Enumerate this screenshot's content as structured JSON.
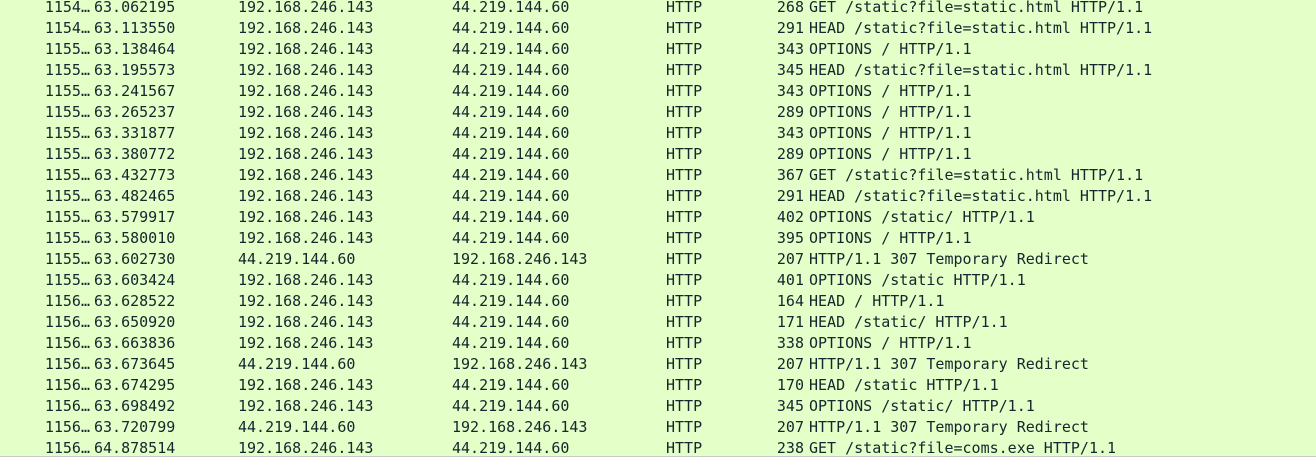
{
  "colors": {
    "row_background": "#e4ffc7",
    "text": "#12272e"
  },
  "packets": [
    {
      "no": "1154…",
      "time": "63.062195",
      "source": "192.168.246.143",
      "destination": "44.219.144.60",
      "protocol": "HTTP",
      "length": "268",
      "info": "GET /static?file=static.html HTTP/1.1"
    },
    {
      "no": "1154…",
      "time": "63.113550",
      "source": "192.168.246.143",
      "destination": "44.219.144.60",
      "protocol": "HTTP",
      "length": "291",
      "info": "HEAD /static?file=static.html HTTP/1.1"
    },
    {
      "no": "1155…",
      "time": "63.138464",
      "source": "192.168.246.143",
      "destination": "44.219.144.60",
      "protocol": "HTTP",
      "length": "343",
      "info": "OPTIONS / HTTP/1.1"
    },
    {
      "no": "1155…",
      "time": "63.195573",
      "source": "192.168.246.143",
      "destination": "44.219.144.60",
      "protocol": "HTTP",
      "length": "345",
      "info": "HEAD /static?file=static.html HTTP/1.1"
    },
    {
      "no": "1155…",
      "time": "63.241567",
      "source": "192.168.246.143",
      "destination": "44.219.144.60",
      "protocol": "HTTP",
      "length": "343",
      "info": "OPTIONS / HTTP/1.1"
    },
    {
      "no": "1155…",
      "time": "63.265237",
      "source": "192.168.246.143",
      "destination": "44.219.144.60",
      "protocol": "HTTP",
      "length": "289",
      "info": "OPTIONS / HTTP/1.1"
    },
    {
      "no": "1155…",
      "time": "63.331877",
      "source": "192.168.246.143",
      "destination": "44.219.144.60",
      "protocol": "HTTP",
      "length": "343",
      "info": "OPTIONS / HTTP/1.1"
    },
    {
      "no": "1155…",
      "time": "63.380772",
      "source": "192.168.246.143",
      "destination": "44.219.144.60",
      "protocol": "HTTP",
      "length": "289",
      "info": "OPTIONS / HTTP/1.1"
    },
    {
      "no": "1155…",
      "time": "63.432773",
      "source": "192.168.246.143",
      "destination": "44.219.144.60",
      "protocol": "HTTP",
      "length": "367",
      "info": "GET /static?file=static.html HTTP/1.1"
    },
    {
      "no": "1155…",
      "time": "63.482465",
      "source": "192.168.246.143",
      "destination": "44.219.144.60",
      "protocol": "HTTP",
      "length": "291",
      "info": "HEAD /static?file=static.html HTTP/1.1"
    },
    {
      "no": "1155…",
      "time": "63.579917",
      "source": "192.168.246.143",
      "destination": "44.219.144.60",
      "protocol": "HTTP",
      "length": "402",
      "info": "OPTIONS /static/ HTTP/1.1"
    },
    {
      "no": "1155…",
      "time": "63.580010",
      "source": "192.168.246.143",
      "destination": "44.219.144.60",
      "protocol": "HTTP",
      "length": "395",
      "info": "OPTIONS / HTTP/1.1"
    },
    {
      "no": "1155…",
      "time": "63.602730",
      "source": "44.219.144.60",
      "destination": "192.168.246.143",
      "protocol": "HTTP",
      "length": "207",
      "info": "HTTP/1.1 307 Temporary Redirect"
    },
    {
      "no": "1155…",
      "time": "63.603424",
      "source": "192.168.246.143",
      "destination": "44.219.144.60",
      "protocol": "HTTP",
      "length": "401",
      "info": "OPTIONS /static HTTP/1.1"
    },
    {
      "no": "1156…",
      "time": "63.628522",
      "source": "192.168.246.143",
      "destination": "44.219.144.60",
      "protocol": "HTTP",
      "length": "164",
      "info": "HEAD / HTTP/1.1"
    },
    {
      "no": "1156…",
      "time": "63.650920",
      "source": "192.168.246.143",
      "destination": "44.219.144.60",
      "protocol": "HTTP",
      "length": "171",
      "info": "HEAD /static/ HTTP/1.1"
    },
    {
      "no": "1156…",
      "time": "63.663836",
      "source": "192.168.246.143",
      "destination": "44.219.144.60",
      "protocol": "HTTP",
      "length": "338",
      "info": "OPTIONS / HTTP/1.1"
    },
    {
      "no": "1156…",
      "time": "63.673645",
      "source": "44.219.144.60",
      "destination": "192.168.246.143",
      "protocol": "HTTP",
      "length": "207",
      "info": "HTTP/1.1 307 Temporary Redirect"
    },
    {
      "no": "1156…",
      "time": "63.674295",
      "source": "192.168.246.143",
      "destination": "44.219.144.60",
      "protocol": "HTTP",
      "length": "170",
      "info": "HEAD /static HTTP/1.1"
    },
    {
      "no": "1156…",
      "time": "63.698492",
      "source": "192.168.246.143",
      "destination": "44.219.144.60",
      "protocol": "HTTP",
      "length": "345",
      "info": "OPTIONS /static/ HTTP/1.1"
    },
    {
      "no": "1156…",
      "time": "63.720799",
      "source": "44.219.144.60",
      "destination": "192.168.246.143",
      "protocol": "HTTP",
      "length": "207",
      "info": "HTTP/1.1 307 Temporary Redirect"
    },
    {
      "no": "1156…",
      "time": "64.878514",
      "source": "192.168.246.143",
      "destination": "44.219.144.60",
      "protocol": "HTTP",
      "length": "238",
      "info": "GET /static?file=coms.exe HTTP/1.1"
    }
  ]
}
